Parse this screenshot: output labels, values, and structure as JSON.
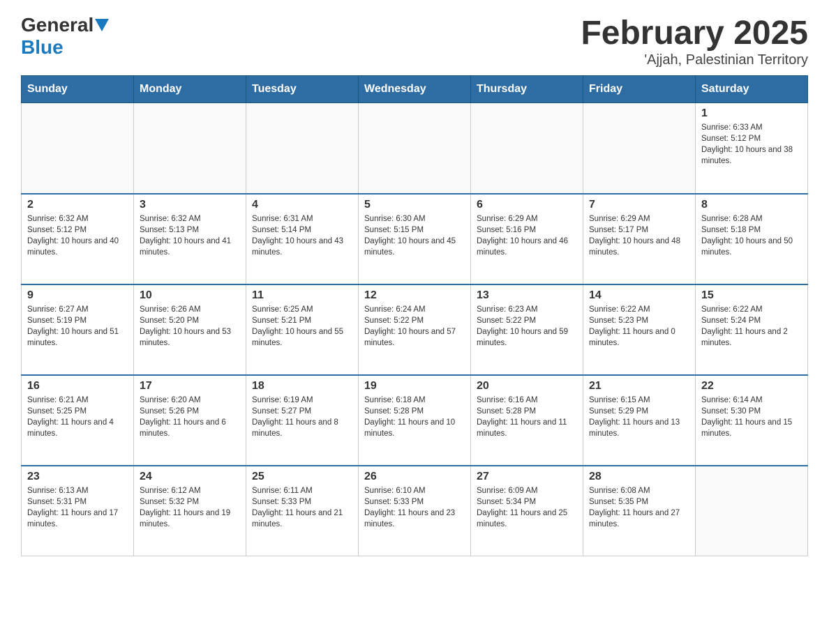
{
  "header": {
    "logo_general": "General",
    "logo_blue": "Blue",
    "month_title": "February 2025",
    "subtitle": "'Ajjah, Palestinian Territory"
  },
  "days_of_week": [
    "Sunday",
    "Monday",
    "Tuesday",
    "Wednesday",
    "Thursday",
    "Friday",
    "Saturday"
  ],
  "weeks": [
    [
      {
        "day": "",
        "info": ""
      },
      {
        "day": "",
        "info": ""
      },
      {
        "day": "",
        "info": ""
      },
      {
        "day": "",
        "info": ""
      },
      {
        "day": "",
        "info": ""
      },
      {
        "day": "",
        "info": ""
      },
      {
        "day": "1",
        "info": "Sunrise: 6:33 AM\nSunset: 5:12 PM\nDaylight: 10 hours and 38 minutes."
      }
    ],
    [
      {
        "day": "2",
        "info": "Sunrise: 6:32 AM\nSunset: 5:12 PM\nDaylight: 10 hours and 40 minutes."
      },
      {
        "day": "3",
        "info": "Sunrise: 6:32 AM\nSunset: 5:13 PM\nDaylight: 10 hours and 41 minutes."
      },
      {
        "day": "4",
        "info": "Sunrise: 6:31 AM\nSunset: 5:14 PM\nDaylight: 10 hours and 43 minutes."
      },
      {
        "day": "5",
        "info": "Sunrise: 6:30 AM\nSunset: 5:15 PM\nDaylight: 10 hours and 45 minutes."
      },
      {
        "day": "6",
        "info": "Sunrise: 6:29 AM\nSunset: 5:16 PM\nDaylight: 10 hours and 46 minutes."
      },
      {
        "day": "7",
        "info": "Sunrise: 6:29 AM\nSunset: 5:17 PM\nDaylight: 10 hours and 48 minutes."
      },
      {
        "day": "8",
        "info": "Sunrise: 6:28 AM\nSunset: 5:18 PM\nDaylight: 10 hours and 50 minutes."
      }
    ],
    [
      {
        "day": "9",
        "info": "Sunrise: 6:27 AM\nSunset: 5:19 PM\nDaylight: 10 hours and 51 minutes."
      },
      {
        "day": "10",
        "info": "Sunrise: 6:26 AM\nSunset: 5:20 PM\nDaylight: 10 hours and 53 minutes."
      },
      {
        "day": "11",
        "info": "Sunrise: 6:25 AM\nSunset: 5:21 PM\nDaylight: 10 hours and 55 minutes."
      },
      {
        "day": "12",
        "info": "Sunrise: 6:24 AM\nSunset: 5:22 PM\nDaylight: 10 hours and 57 minutes."
      },
      {
        "day": "13",
        "info": "Sunrise: 6:23 AM\nSunset: 5:22 PM\nDaylight: 10 hours and 59 minutes."
      },
      {
        "day": "14",
        "info": "Sunrise: 6:22 AM\nSunset: 5:23 PM\nDaylight: 11 hours and 0 minutes."
      },
      {
        "day": "15",
        "info": "Sunrise: 6:22 AM\nSunset: 5:24 PM\nDaylight: 11 hours and 2 minutes."
      }
    ],
    [
      {
        "day": "16",
        "info": "Sunrise: 6:21 AM\nSunset: 5:25 PM\nDaylight: 11 hours and 4 minutes."
      },
      {
        "day": "17",
        "info": "Sunrise: 6:20 AM\nSunset: 5:26 PM\nDaylight: 11 hours and 6 minutes."
      },
      {
        "day": "18",
        "info": "Sunrise: 6:19 AM\nSunset: 5:27 PM\nDaylight: 11 hours and 8 minutes."
      },
      {
        "day": "19",
        "info": "Sunrise: 6:18 AM\nSunset: 5:28 PM\nDaylight: 11 hours and 10 minutes."
      },
      {
        "day": "20",
        "info": "Sunrise: 6:16 AM\nSunset: 5:28 PM\nDaylight: 11 hours and 11 minutes."
      },
      {
        "day": "21",
        "info": "Sunrise: 6:15 AM\nSunset: 5:29 PM\nDaylight: 11 hours and 13 minutes."
      },
      {
        "day": "22",
        "info": "Sunrise: 6:14 AM\nSunset: 5:30 PM\nDaylight: 11 hours and 15 minutes."
      }
    ],
    [
      {
        "day": "23",
        "info": "Sunrise: 6:13 AM\nSunset: 5:31 PM\nDaylight: 11 hours and 17 minutes."
      },
      {
        "day": "24",
        "info": "Sunrise: 6:12 AM\nSunset: 5:32 PM\nDaylight: 11 hours and 19 minutes."
      },
      {
        "day": "25",
        "info": "Sunrise: 6:11 AM\nSunset: 5:33 PM\nDaylight: 11 hours and 21 minutes."
      },
      {
        "day": "26",
        "info": "Sunrise: 6:10 AM\nSunset: 5:33 PM\nDaylight: 11 hours and 23 minutes."
      },
      {
        "day": "27",
        "info": "Sunrise: 6:09 AM\nSunset: 5:34 PM\nDaylight: 11 hours and 25 minutes."
      },
      {
        "day": "28",
        "info": "Sunrise: 6:08 AM\nSunset: 5:35 PM\nDaylight: 11 hours and 27 minutes."
      },
      {
        "day": "",
        "info": ""
      }
    ]
  ]
}
